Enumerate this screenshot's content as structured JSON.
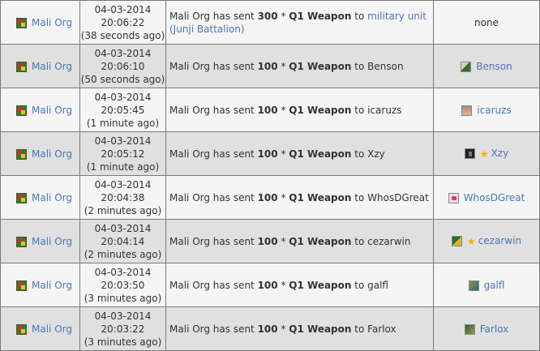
{
  "rows": [
    {
      "from": "Mali Org",
      "date": "04-03-2014",
      "time": "20:06:22",
      "ago": "(38 seconds ago)",
      "msg_pre": "Mali Org has sent ",
      "qty": "300",
      "mult": " * ",
      "item": "Q1 Weapon",
      "to_word": " to ",
      "recipient": "military unit (Junji Battalion)",
      "to_col": "none"
    },
    {
      "from": "Mali Org",
      "date": "04-03-2014",
      "time": "20:06:10",
      "ago": "(50 seconds ago)",
      "msg_pre": "Mali Org has sent ",
      "qty": "100",
      "mult": " * ",
      "item": "Q1 Weapon",
      "to_word": " to ",
      "recipient": "Benson",
      "to_col": "Benson"
    },
    {
      "from": "Mali Org",
      "date": "04-03-2014",
      "time": "20:05:45",
      "ago": "(1 minute ago)",
      "msg_pre": "Mali Org has sent ",
      "qty": "100",
      "mult": " * ",
      "item": "Q1 Weapon",
      "to_word": " to ",
      "recipient": "icaruzs",
      "to_col": "icaruzs"
    },
    {
      "from": "Mali Org",
      "date": "04-03-2014",
      "time": "20:05:12",
      "ago": "(1 minute ago)",
      "msg_pre": "Mali Org has sent ",
      "qty": "100",
      "mult": " * ",
      "item": "Q1 Weapon",
      "to_word": " to ",
      "recipient": "Xzy",
      "to_col": "Xzy"
    },
    {
      "from": "Mali Org",
      "date": "04-03-2014",
      "time": "20:04:38",
      "ago": "(2 minutes ago)",
      "msg_pre": "Mali Org has sent ",
      "qty": "100",
      "mult": " * ",
      "item": "Q1 Weapon",
      "to_word": " to ",
      "recipient": "WhosDGreat",
      "to_col": "WhosDGreat"
    },
    {
      "from": "Mali Org",
      "date": "04-03-2014",
      "time": "20:04:14",
      "ago": "(2 minutes ago)",
      "msg_pre": "Mali Org has sent ",
      "qty": "100",
      "mult": " * ",
      "item": "Q1 Weapon",
      "to_word": " to ",
      "recipient": "cezarwin",
      "to_col": "cezarwin"
    },
    {
      "from": "Mali Org",
      "date": "04-03-2014",
      "time": "20:03:50",
      "ago": "(3 minutes ago)",
      "msg_pre": "Mali Org has sent ",
      "qty": "100",
      "mult": " * ",
      "item": "Q1 Weapon",
      "to_word": " to ",
      "recipient": "galfl",
      "to_col": "galfl"
    },
    {
      "from": "Mali Org",
      "date": "04-03-2014",
      "time": "20:03:22",
      "ago": "(3 minutes ago)",
      "msg_pre": "Mali Org has sent ",
      "qty": "100",
      "mult": " * ",
      "item": "Q1 Weapon",
      "to_word": " to ",
      "recipient": "Farlox",
      "to_col": "Farlox"
    }
  ],
  "colors": {
    "link": "#4a76b8",
    "row_light": "#f5f5f5",
    "row_dark": "#e0e0e0",
    "border": "#7a7a7a",
    "star": "#f0b400"
  }
}
